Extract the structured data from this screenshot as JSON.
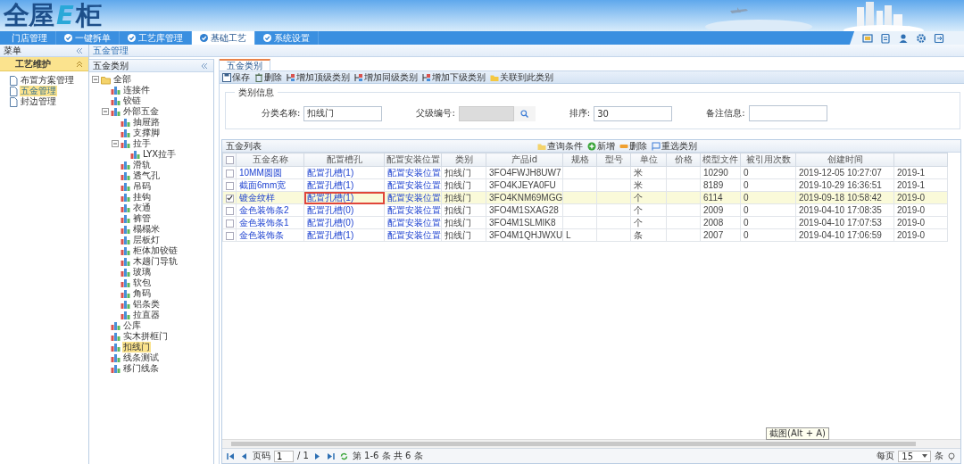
{
  "header": {
    "logo": {
      "before": "全屋",
      "mark": "E",
      "after": "柜"
    }
  },
  "nav": {
    "tabs": [
      {
        "label": "门店管理",
        "icon": false,
        "selected": false
      },
      {
        "label": "一键拆单",
        "icon": true,
        "selected": false
      },
      {
        "label": "工艺库管理",
        "icon": true,
        "selected": false
      },
      {
        "label": "基础工艺",
        "icon": true,
        "selected": true
      },
      {
        "label": "系统设置",
        "icon": true,
        "selected": false
      }
    ]
  },
  "sidebar": {
    "title": "菜单",
    "section": "工艺维护",
    "items": [
      {
        "label": "布置方案管理",
        "selected": false
      },
      {
        "label": "五金管理",
        "selected": true
      },
      {
        "label": "封边管理",
        "selected": false
      }
    ]
  },
  "breadcrumb": "五金管理",
  "tree": {
    "title": "五金类别",
    "nodes": [
      {
        "label": "全部",
        "kind": "folder",
        "expanded": true,
        "selected": false,
        "children": [
          {
            "label": "连接件",
            "kind": "category",
            "selected": false
          },
          {
            "label": "铰链",
            "kind": "category",
            "selected": false
          },
          {
            "label": "外部五金",
            "kind": "category",
            "expanded": true,
            "selected": false,
            "children": [
              {
                "label": "抽屉路",
                "kind": "category",
                "selected": false
              },
              {
                "label": "支撑脚",
                "kind": "category",
                "selected": false
              },
              {
                "label": "拉手",
                "kind": "category",
                "expanded": true,
                "selected": false,
                "children": [
                  {
                    "label": "LYX拉手",
                    "kind": "category",
                    "selected": false
                  }
                ]
              },
              {
                "label": "滑轨",
                "kind": "category",
                "selected": false
              },
              {
                "label": "透气孔",
                "kind": "category",
                "selected": false
              },
              {
                "label": "吊码",
                "kind": "category",
                "selected": false
              },
              {
                "label": "挂钩",
                "kind": "category",
                "selected": false
              },
              {
                "label": "衣通",
                "kind": "category",
                "selected": false
              },
              {
                "label": "裤管",
                "kind": "category",
                "selected": false
              },
              {
                "label": "榻榻米",
                "kind": "category",
                "selected": false
              },
              {
                "label": "层板灯",
                "kind": "category",
                "selected": false
              },
              {
                "label": "柜体加铰链",
                "kind": "category",
                "selected": false
              },
              {
                "label": "木趟门导轨",
                "kind": "category",
                "selected": false
              },
              {
                "label": "玻璃",
                "kind": "category",
                "selected": false
              },
              {
                "label": "软包",
                "kind": "category",
                "selected": false
              },
              {
                "label": "角码",
                "kind": "category",
                "selected": false
              },
              {
                "label": "铝条类",
                "kind": "category",
                "selected": false
              },
              {
                "label": "拉直器",
                "kind": "category",
                "selected": false
              }
            ]
          },
          {
            "label": "公库",
            "kind": "category",
            "selected": false
          },
          {
            "label": "实木拼框门",
            "kind": "category",
            "selected": false
          },
          {
            "label": "扣线门",
            "kind": "category",
            "selected": true
          },
          {
            "label": "线条测试",
            "kind": "category",
            "selected": false
          },
          {
            "label": "移门线条",
            "kind": "category",
            "selected": false
          }
        ]
      }
    ]
  },
  "editor": {
    "tab": "五金类别",
    "toolbar": [
      {
        "label": "保存",
        "kind": "save"
      },
      {
        "label": "删除",
        "kind": "delete"
      },
      {
        "label": "增加顶级类别",
        "kind": "add"
      },
      {
        "label": "增加同级类别",
        "kind": "add"
      },
      {
        "label": "增加下级类别",
        "kind": "add"
      },
      {
        "label": "关联到此类别",
        "kind": "link"
      }
    ],
    "fieldset": "类别信息",
    "fields": [
      {
        "label": "分类名称:",
        "value": "扣线门",
        "kind": "text"
      },
      {
        "label": "父级编号:",
        "kind": "lookup",
        "disabled": true
      },
      {
        "label": "排序:",
        "value": "30",
        "kind": "text"
      },
      {
        "label": "备注信息:",
        "kind": "textarea"
      }
    ]
  },
  "grid": {
    "title": "五金列表",
    "actions": [
      {
        "label": "查询条件",
        "kind": "query"
      },
      {
        "label": "新增",
        "kind": "add"
      },
      {
        "label": "删除",
        "kind": "delete"
      },
      {
        "label": "重选类别",
        "kind": "reselect"
      }
    ],
    "all_checked": false,
    "columns": [
      "五金名称",
      "配置槽孔",
      "配置安装位置",
      "类别",
      "产品id",
      "规格",
      "型号",
      "单位",
      "价格",
      "模型文件",
      "被引用次数",
      "创建时间"
    ],
    "rows": [
      {
        "checked": false,
        "outlined": false,
        "cells": [
          "10MM圆圆",
          "配置孔槽(1)",
          "配置安装位置",
          "扣线门",
          "3FO4FWJH8UW7",
          "",
          "",
          "米",
          "",
          "10290",
          "0",
          "2019-12-05 10:27:07",
          "2019-1"
        ]
      },
      {
        "checked": false,
        "outlined": false,
        "cells": [
          "截面6mm宽",
          "配置孔槽(1)",
          "配置安装位置",
          "扣线门",
          "3FO4KJEYA0FU",
          "",
          "",
          "米",
          "",
          "8189",
          "0",
          "2019-10-29 16:36:51",
          "2019-1"
        ]
      },
      {
        "checked": true,
        "outlined": true,
        "cells": [
          "镀金纹样",
          "配置孔槽(1)",
          "配置安装位置",
          "扣线门",
          "3FO4KNM69MGG",
          "",
          "",
          "个",
          "",
          "6114",
          "0",
          "2019-09-18 10:58:42",
          "2019-0"
        ]
      },
      {
        "checked": false,
        "outlined": false,
        "cells": [
          "金色装饰条2",
          "配置孔槽(0)",
          "配置安装位置",
          "扣线门",
          "3FO4M1SXAG28",
          "",
          "",
          "个",
          "",
          "2009",
          "0",
          "2019-04-10 17:08:35",
          "2019-0"
        ]
      },
      {
        "checked": false,
        "outlined": false,
        "cells": [
          "金色装饰条1",
          "配置孔槽(0)",
          "配置安装位置",
          "扣线门",
          "3FO4M1SLMIK8",
          "",
          "",
          "个",
          "",
          "2008",
          "0",
          "2019-04-10 17:07:53",
          "2019-0"
        ]
      },
      {
        "checked": false,
        "outlined": false,
        "cells": [
          "金色装饰条",
          "配置孔槽(1)",
          "配置安装位置",
          "扣线门",
          "3FO4M1QHJWXU",
          "L",
          "",
          "条",
          "",
          "2007",
          "0",
          "2019-04-10 17:06:59",
          "2019-0"
        ]
      }
    ],
    "pager": {
      "page_label": "页码",
      "page": "1",
      "of": "/ 1",
      "summary": "第 1-6 条 共 6 条",
      "per_page_label": "每页",
      "per_page": "15",
      "unit": "条"
    },
    "tooltip": "截图(Alt + A)"
  }
}
